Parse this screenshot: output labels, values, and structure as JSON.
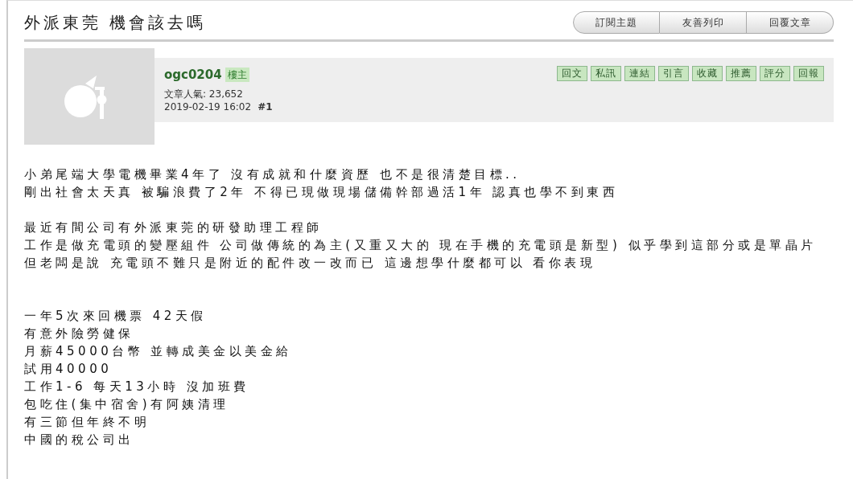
{
  "topic": {
    "title": "外派東莞 機會該去嗎"
  },
  "topic_buttons": [
    "訂閱主題",
    "友善列印",
    "回覆文章"
  ],
  "post": {
    "author": "ogc0204",
    "author_badge": "樓主",
    "views": "文章人氣: 23,652",
    "date": "2019-02-19 16:02",
    "floor": "#1",
    "actions": [
      "回文",
      "私訊",
      "連結",
      "引言",
      "收藏",
      "推薦",
      "評分",
      "回報"
    ],
    "paragraphs": [
      {
        "lines": [
          "小弟尾端大學電機畢業4年了 沒有成就和什麼資歷 也不是很清楚目標..",
          "剛出社會太天真 被騙浪費了2年 不得已現做現場儲備幹部過活1年 認真也學不到東西"
        ]
      },
      {
        "lines": [
          "最近有間公司有外派東莞的研發助理工程師",
          "工作是做充電頭的變壓組件 公司做傳統的為主(又重又大的 現在手機的充電頭是新型) 似乎學到這部分或是單晶片",
          "但老闆是說 充電頭不難只是附近的配件改一改而已 這邊想學什麼都可以 看你表現"
        ]
      },
      {
        "lines": [
          "一年5次來回機票 42天假",
          "有意外險勞健保",
          "月薪45000台幣 並轉成美金以美金給",
          "試用40000",
          "工作1-6 每天13小時 沒加班費",
          "包吃住(集中宿舍)有阿姨清理",
          "有三節但年終不明",
          "中國的稅公司出"
        ]
      }
    ]
  }
}
